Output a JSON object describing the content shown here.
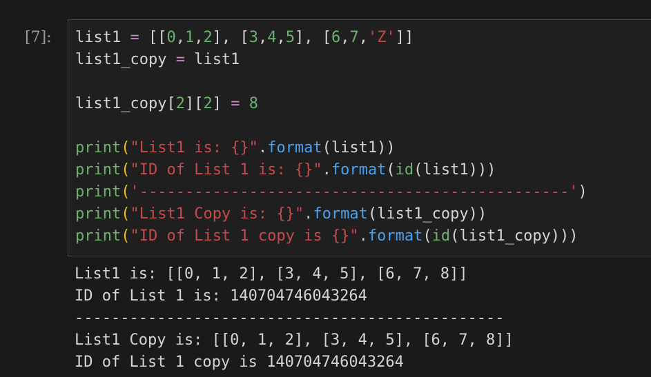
{
  "execution_count": "[7]:",
  "code_lines": [
    [
      {
        "t": "list1 ",
        "c": "var"
      },
      {
        "t": "=",
        "c": "op"
      },
      {
        "t": " [[",
        "c": "var"
      },
      {
        "t": "0",
        "c": "num"
      },
      {
        "t": ",",
        "c": "var"
      },
      {
        "t": "1",
        "c": "num"
      },
      {
        "t": ",",
        "c": "var"
      },
      {
        "t": "2",
        "c": "num"
      },
      {
        "t": "], [",
        "c": "var"
      },
      {
        "t": "3",
        "c": "num"
      },
      {
        "t": ",",
        "c": "var"
      },
      {
        "t": "4",
        "c": "num"
      },
      {
        "t": ",",
        "c": "var"
      },
      {
        "t": "5",
        "c": "num"
      },
      {
        "t": "], [",
        "c": "var"
      },
      {
        "t": "6",
        "c": "num"
      },
      {
        "t": ",",
        "c": "var"
      },
      {
        "t": "7",
        "c": "num"
      },
      {
        "t": ",",
        "c": "var"
      },
      {
        "t": "'Z'",
        "c": "str"
      },
      {
        "t": "]]",
        "c": "var"
      }
    ],
    [
      {
        "t": "list1_copy ",
        "c": "var"
      },
      {
        "t": "=",
        "c": "op"
      },
      {
        "t": " list1",
        "c": "var"
      }
    ],
    [],
    [
      {
        "t": "list1_copy[",
        "c": "var"
      },
      {
        "t": "2",
        "c": "num"
      },
      {
        "t": "][",
        "c": "var"
      },
      {
        "t": "2",
        "c": "num"
      },
      {
        "t": "] ",
        "c": "var"
      },
      {
        "t": "=",
        "c": "op"
      },
      {
        "t": " ",
        "c": "var"
      },
      {
        "t": "8",
        "c": "num"
      }
    ],
    [],
    [
      {
        "t": "print",
        "c": "bi"
      },
      {
        "t": "(",
        "c": "br1"
      },
      {
        "t": "\"List1 is: {}\"",
        "c": "str"
      },
      {
        "t": ".",
        "c": "var"
      },
      {
        "t": "format",
        "c": "fn"
      },
      {
        "t": "(list1))",
        "c": "var"
      }
    ],
    [
      {
        "t": "print",
        "c": "bi"
      },
      {
        "t": "(",
        "c": "br1"
      },
      {
        "t": "\"ID of List 1 is: {}\"",
        "c": "str"
      },
      {
        "t": ".",
        "c": "var"
      },
      {
        "t": "format",
        "c": "fn"
      },
      {
        "t": "(",
        "c": "var"
      },
      {
        "t": "id",
        "c": "bi"
      },
      {
        "t": "(list1)))",
        "c": "var"
      }
    ],
    [
      {
        "t": "print",
        "c": "bi"
      },
      {
        "t": "(",
        "c": "br1"
      },
      {
        "t": "'-----------------------------------------------'",
        "c": "str"
      },
      {
        "t": ")",
        "c": "var"
      }
    ],
    [
      {
        "t": "print",
        "c": "bi"
      },
      {
        "t": "(",
        "c": "br1"
      },
      {
        "t": "\"List1 Copy is: {}\"",
        "c": "str"
      },
      {
        "t": ".",
        "c": "var"
      },
      {
        "t": "format",
        "c": "fn"
      },
      {
        "t": "(list1_copy))",
        "c": "var"
      }
    ],
    [
      {
        "t": "print",
        "c": "bi"
      },
      {
        "t": "(",
        "c": "br1"
      },
      {
        "t": "\"ID of List 1 copy is {}\"",
        "c": "str"
      },
      {
        "t": ".",
        "c": "var"
      },
      {
        "t": "format",
        "c": "fn"
      },
      {
        "t": "(",
        "c": "var"
      },
      {
        "t": "id",
        "c": "bi"
      },
      {
        "t": "(list1_copy)))",
        "c": "var"
      }
    ]
  ],
  "output_lines": [
    "List1 is: [[0, 1, 2], [3, 4, 5], [6, 7, 8]]",
    "ID of List 1 is: 140704746043264",
    "-----------------------------------------------",
    "List1 Copy is: [[0, 1, 2], [3, 4, 5], [6, 7, 8]]",
    "ID of List 1 copy is 140704746043264"
  ]
}
